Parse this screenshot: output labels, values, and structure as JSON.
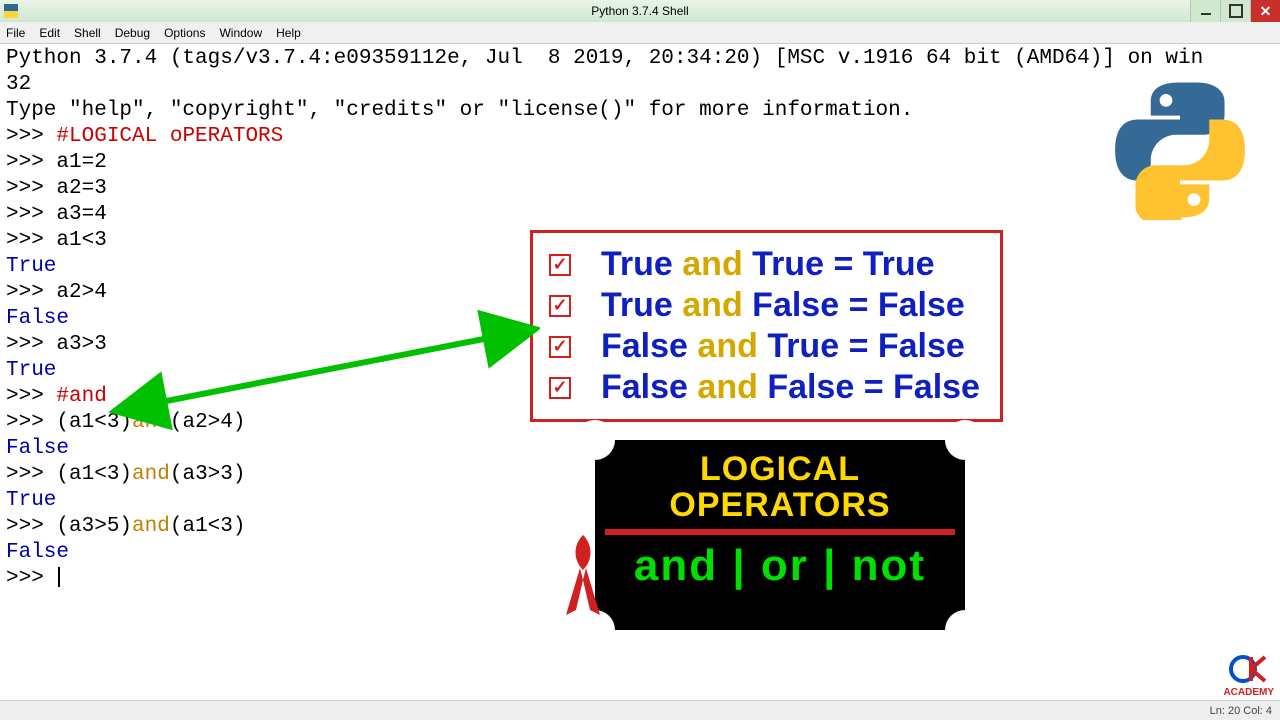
{
  "window": {
    "title": "Python 3.7.4 Shell"
  },
  "menu": {
    "file": "File",
    "edit": "Edit",
    "shell": "Shell",
    "debug": "Debug",
    "options": "Options",
    "window": "Window",
    "help": "Help"
  },
  "banner": {
    "line1": "Python 3.7.4 (tags/v3.7.4:e09359112e, Jul  8 2019, 20:34:20) [MSC v.1916 64 bit (AMD64)] on win",
    "line2": "32",
    "line3": "Type \"help\", \"copyright\", \"credits\" or \"license()\" for more information."
  },
  "session": {
    "prompt": ">>> ",
    "comment1": "#LOGICAL oPERATORS",
    "l1": "a1=2",
    "l2": "a2=3",
    "l3": "a3=4",
    "l4": "a1<3",
    "o4": "True",
    "l5": "a2>4",
    "o5": "False",
    "l6": "a3>3",
    "o6": "True",
    "comment2": "#and",
    "l7a": "(a1<3)",
    "l7k": "and",
    "l7b": "(a2>4)",
    "o7": "False",
    "l8a": "(a1<3)",
    "l8k": "and",
    "l8b": "(a3>3)",
    "o8": "True",
    "l9a": "(a3>5)",
    "l9k": "and",
    "l9b": "(a1<3)",
    "o9": "False"
  },
  "truthbox": {
    "rows": [
      {
        "a": "True",
        "op": "and",
        "b": "True",
        "eq": "= True"
      },
      {
        "a": "True",
        "op": "and",
        "b": "False",
        "eq": "= False"
      },
      {
        "a": "False",
        "op": "and",
        "b": "True",
        "eq": "= False"
      },
      {
        "a": "False",
        "op": "and",
        "b": "False",
        "eq": "= False"
      }
    ]
  },
  "opbox": {
    "title1": "LOGICAL",
    "title2": "OPERATORS",
    "ops": "and | or | not"
  },
  "status": {
    "pos": "Ln: 20  Col: 4"
  },
  "academy": {
    "text": "ACADEMY"
  }
}
